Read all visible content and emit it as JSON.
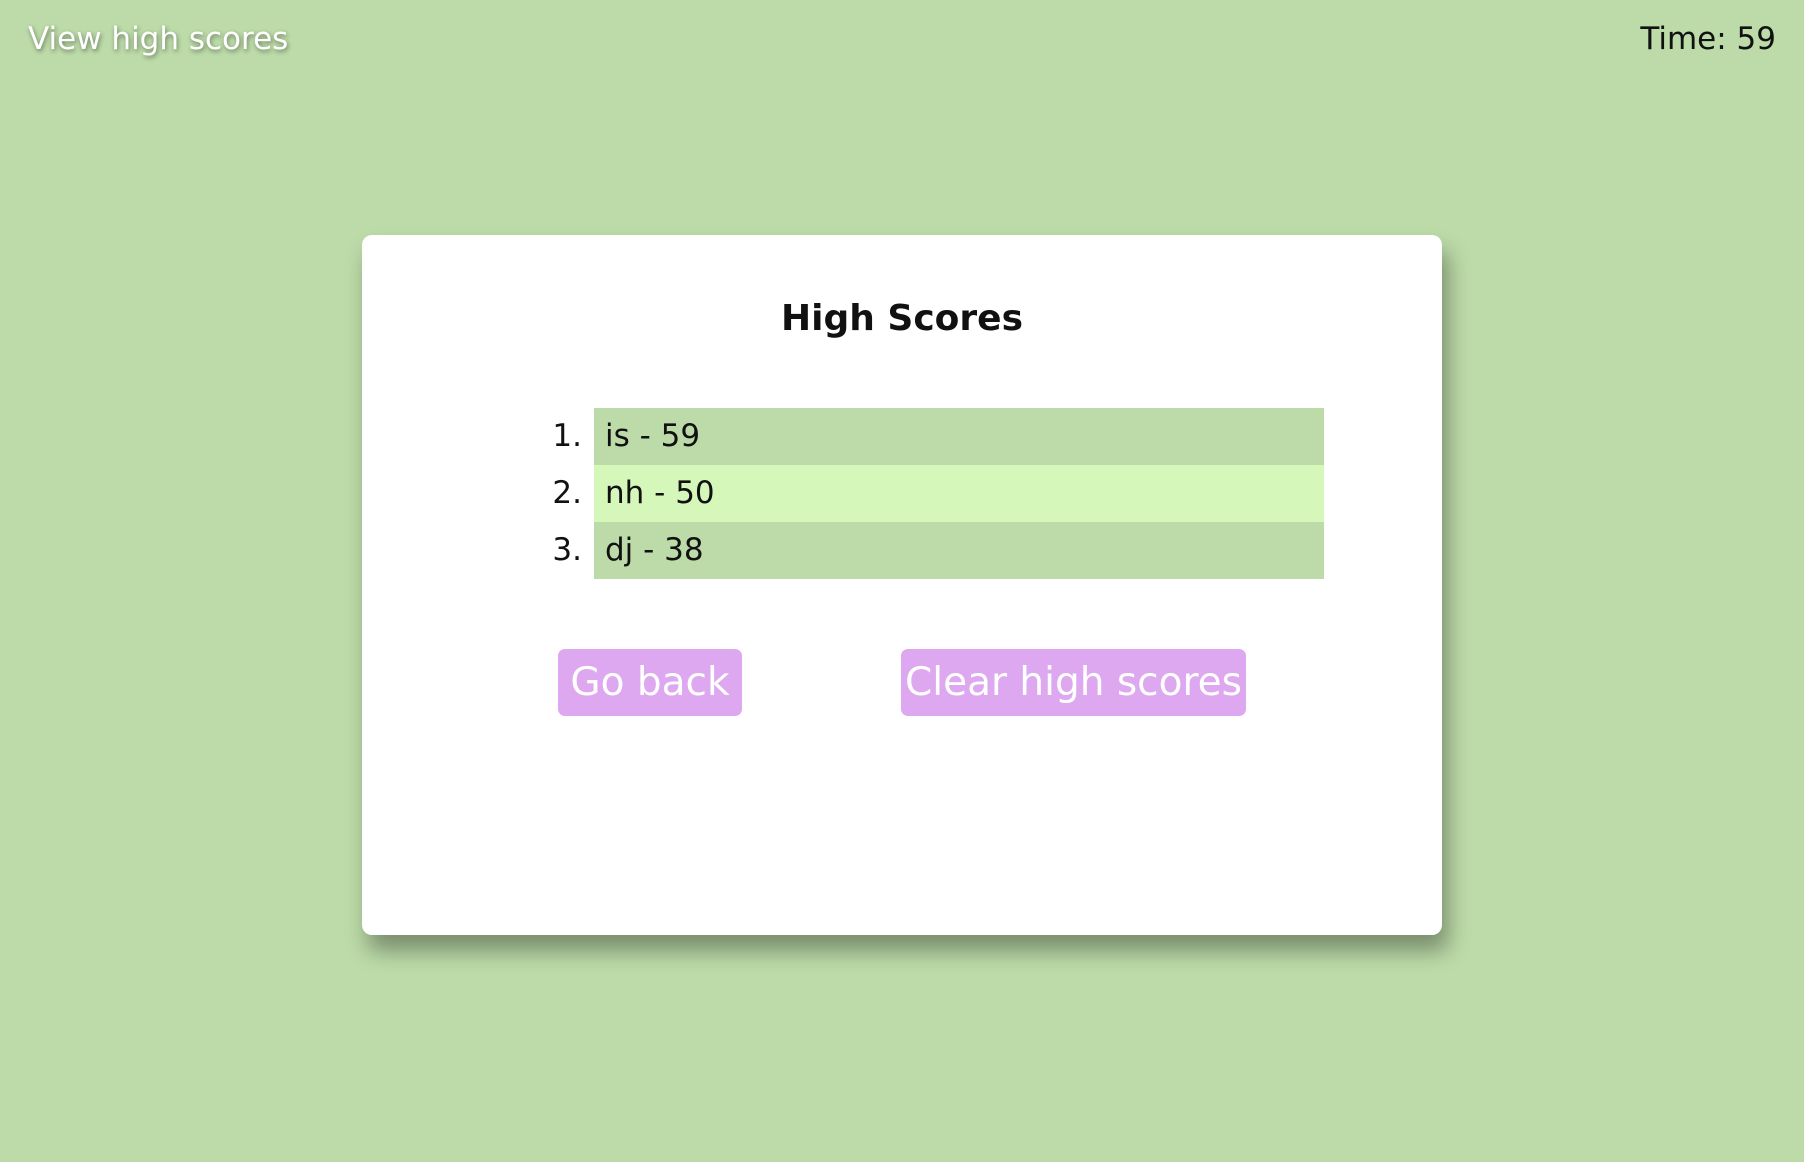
{
  "header": {
    "view_high_scores": "View high scores",
    "timer": "Time: 59"
  },
  "card": {
    "title": "High Scores",
    "scores": [
      {
        "rank": "1.",
        "entry": "is - 59"
      },
      {
        "rank": "2.",
        "entry": "nh - 50"
      },
      {
        "rank": "3.",
        "entry": "dj - 38"
      }
    ],
    "go_back_label": "Go back",
    "clear_label": "Clear high scores"
  },
  "colors": {
    "background": "#bcdba8",
    "row_alt": "#d5f8ba",
    "button": "#dda8ef",
    "card": "#ffffff"
  }
}
